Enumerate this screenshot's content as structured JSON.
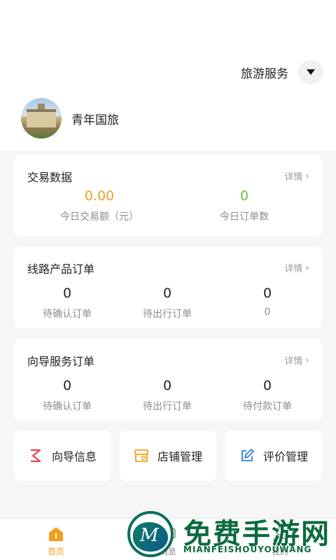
{
  "header": {
    "service_label": "旅游服务",
    "org_name": "青年国旅"
  },
  "trade_card": {
    "title": "交易数据",
    "detail": "详情",
    "stats": [
      {
        "value": "0.00",
        "label": "今日交易额（元）",
        "color": "#f2a11d"
      },
      {
        "value": "0",
        "label": "今日订单数",
        "color": "#6cc24a"
      }
    ]
  },
  "route_card": {
    "title": "线路产品订单",
    "detail": "详情",
    "stats": [
      {
        "value": "0",
        "label": "待确认订单"
      },
      {
        "value": "0",
        "label": "待出行订单"
      },
      {
        "value": "0",
        "label": "0"
      }
    ]
  },
  "guide_card": {
    "title": "向导服务订单",
    "detail": "详情",
    "stats": [
      {
        "value": "0",
        "label": "待确认订单"
      },
      {
        "value": "0",
        "label": "待出行订单"
      },
      {
        "value": "0",
        "label": "待付款订单"
      }
    ]
  },
  "quick_actions": [
    {
      "label": "向导信息",
      "icon": "guide-icon",
      "color": "#e8435a"
    },
    {
      "label": "店铺管理",
      "icon": "store-icon",
      "color": "#f2a11d"
    },
    {
      "label": "评价管理",
      "icon": "edit-icon",
      "color": "#2f7fe0"
    }
  ],
  "tabs": [
    {
      "label": "首页",
      "icon": "home-icon"
    },
    {
      "label": "消息",
      "icon": "message-icon"
    },
    {
      "label": "我的",
      "icon": "profile-icon"
    }
  ],
  "watermark": {
    "title": "免费手游网",
    "subtitle": "MIANFEISHOUYOUWANG"
  }
}
